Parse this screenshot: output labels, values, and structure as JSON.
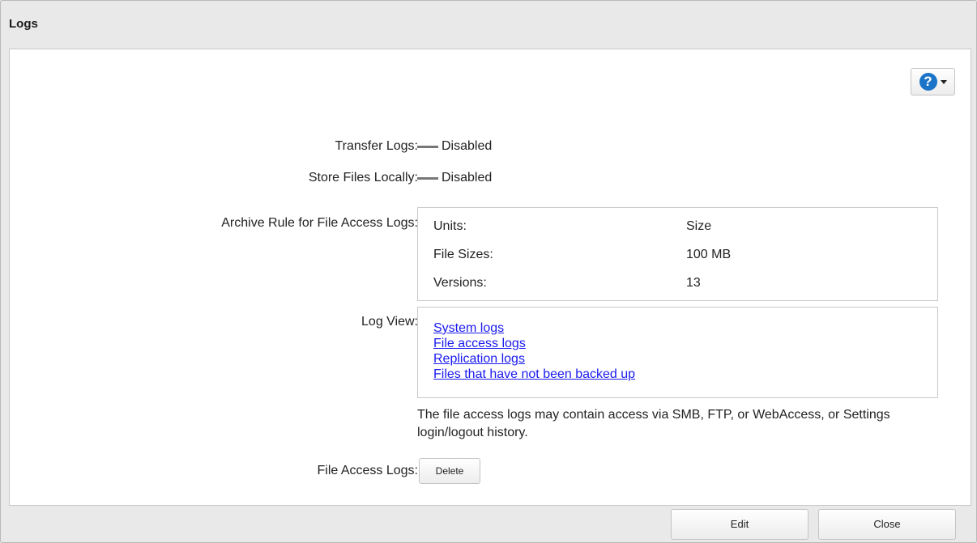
{
  "window": {
    "title": "Logs"
  },
  "help": {
    "icon": "help-icon",
    "glyph": "?"
  },
  "transfer_logs": {
    "label": "Transfer Logs:",
    "value": "Disabled"
  },
  "store_files": {
    "label": "Store Files Locally:",
    "value": "Disabled"
  },
  "archive_rule": {
    "label": "Archive Rule for File Access Logs:",
    "rows": [
      {
        "key": "Units:",
        "value": "Size"
      },
      {
        "key": "File Sizes:",
        "value": "100 MB"
      },
      {
        "key": "Versions:",
        "value": "13"
      }
    ]
  },
  "log_view": {
    "label": "Log View:",
    "links": [
      "System logs",
      "File access logs",
      "Replication logs",
      "Files that have not been backed up"
    ]
  },
  "note": "The file access logs may contain access via SMB, FTP, or WebAccess, or Settings login/logout history.",
  "file_access_logs": {
    "label": "File Access Logs:",
    "button": "Delete"
  },
  "footer": {
    "edit_label": "Edit",
    "close_label": "Close"
  }
}
